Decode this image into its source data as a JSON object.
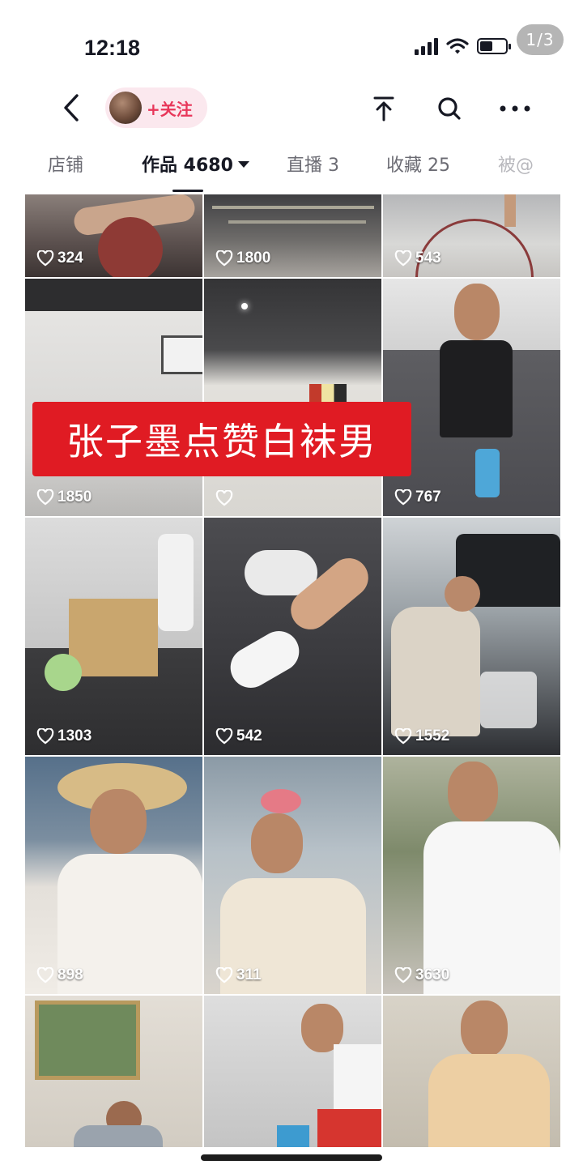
{
  "page_indicator": "1/3",
  "status_bar": {
    "time": "12:18"
  },
  "header": {
    "back_icon": "chevron-left-icon",
    "follow_label": "+关注",
    "icons": [
      "share-top-icon",
      "search-icon",
      "more-icon"
    ]
  },
  "tabs": [
    {
      "label": "店铺"
    },
    {
      "label": "作品 4680",
      "active": true
    },
    {
      "label": "直播 3"
    },
    {
      "label": "收藏 25"
    },
    {
      "label": "被@"
    }
  ],
  "banner_text": "张子墨点赞白袜男",
  "videos": [
    {
      "likes": "324"
    },
    {
      "likes": "1800"
    },
    {
      "likes": "543"
    },
    {
      "likes": "1850"
    },
    {
      "likes": ""
    },
    {
      "likes": "767"
    },
    {
      "likes": "1303"
    },
    {
      "likes": "542"
    },
    {
      "likes": "1552"
    },
    {
      "likes": "898"
    },
    {
      "likes": "311"
    },
    {
      "likes": "3630"
    },
    {
      "likes": ""
    },
    {
      "likes": ""
    },
    {
      "likes": ""
    }
  ],
  "colors": {
    "accent_red": "#e01b23",
    "follow_pink": "#fbe8ee",
    "follow_text": "#e8375a"
  }
}
